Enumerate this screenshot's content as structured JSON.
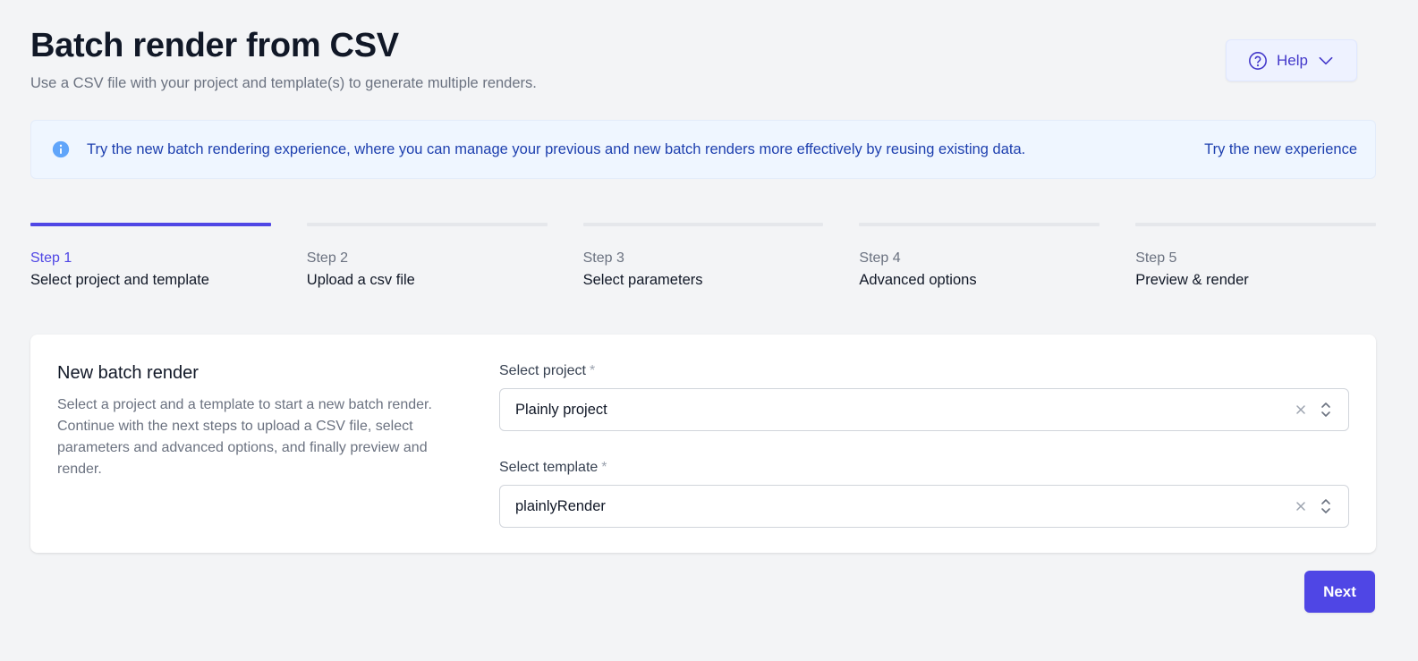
{
  "header": {
    "title": "Batch render from CSV",
    "subtitle": "Use a CSV file with your project and template(s) to generate multiple renders.",
    "help_label": "Help"
  },
  "banner": {
    "icon": "info-icon",
    "text": "Try the new batch rendering experience, where you can manage your previous and new batch renders more effectively by reusing existing data.",
    "link": "Try the new experience"
  },
  "steps": [
    {
      "number": "Step 1",
      "label": "Select project and template",
      "active": true
    },
    {
      "number": "Step 2",
      "label": "Upload a csv file",
      "active": false
    },
    {
      "number": "Step 3",
      "label": "Select parameters",
      "active": false
    },
    {
      "number": "Step 4",
      "label": "Advanced options",
      "active": false
    },
    {
      "number": "Step 5",
      "label": "Preview & render",
      "active": false
    }
  ],
  "card": {
    "title": "New batch render",
    "description": "Select a project and a template to start a new batch render. Continue with the next steps to upload a CSV file, select parameters and advanced options, and finally preview and render.",
    "project_field": {
      "label": "Select project",
      "required_mark": "*",
      "value": "Plainly project"
    },
    "template_field": {
      "label": "Select template",
      "required_mark": "*",
      "value": "plainlyRender"
    }
  },
  "actions": {
    "next_label": "Next"
  },
  "colors": {
    "accent": "#4f46e5",
    "banner_bg": "#eff6ff",
    "banner_text": "#1e40af",
    "page_bg": "#f3f4f6"
  }
}
